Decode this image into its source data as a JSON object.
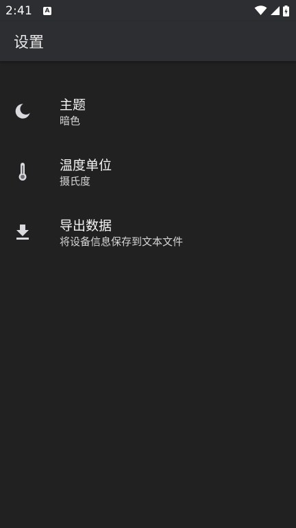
{
  "status_bar": {
    "time": "2:41",
    "app_badge": "A",
    "icons": [
      "wifi-icon",
      "signal-icon",
      "battery-charging-icon"
    ]
  },
  "app_bar": {
    "title": "设置"
  },
  "preferences": [
    {
      "icon": "moon-icon",
      "title": "主题",
      "summary": "暗色"
    },
    {
      "icon": "thermometer-icon",
      "title": "温度单位",
      "summary": "摄氏度"
    },
    {
      "icon": "download-icon",
      "title": "导出数据",
      "summary": "将设备信息保存到文本文件"
    }
  ],
  "colors": {
    "background": "#212121",
    "app_bar": "#2d2e31",
    "icon": "#d9d9de",
    "primary_text": "#f5f5f5",
    "secondary_text": "#d6d6d6"
  }
}
